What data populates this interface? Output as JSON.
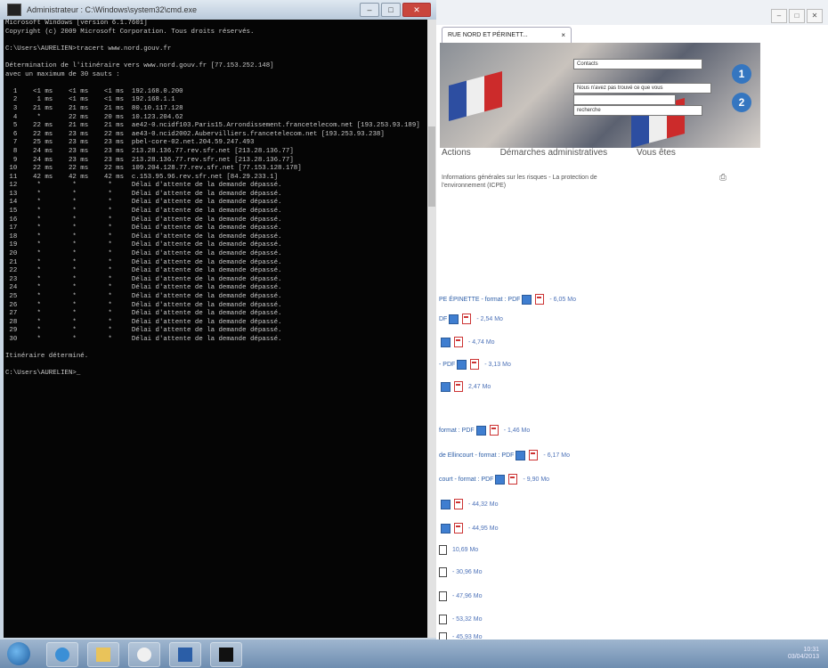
{
  "cmd": {
    "title": "Administrateur : C:\\Windows\\system32\\cmd.exe",
    "window_buttons": {
      "min": "–",
      "max": "□",
      "close": "✕"
    },
    "lines": [
      "Microsoft Windows [version 6.1.7601]",
      "Copyright (c) 2009 Microsoft Corporation. Tous droits réservés.",
      "",
      "C:\\Users\\AURELIEN>tracert www.nord.gouv.fr",
      "",
      "Détermination de l'itinéraire vers www.nord.gouv.fr [77.153.252.148]",
      "avec un maximum de 30 sauts :",
      "",
      "  1    <1 ms    <1 ms    <1 ms  192.168.0.200",
      "  2     1 ms    <1 ms    <1 ms  192.168.1.1",
      "  3    21 ms    21 ms    21 ms  80.10.117.128",
      "  4     *       22 ms    20 ms  10.123.204.62",
      "  5    22 ms    21 ms    21 ms  ae42-0.ncidf103.Paris15.Arrondissement.francetelecom.net [193.253.93.189]",
      "  6    22 ms    23 ms    22 ms  ae43-0.ncid2002.Aubervilliers.francetelecom.net [193.253.93.238]",
      "  7    25 ms    23 ms    23 ms  pbel-core-02.net.204.59.247.493",
      "  8    24 ms    23 ms    23 ms  213.28.136.77.rev.sfr.net [213.28.136.77]",
      "  9    24 ms    23 ms    23 ms  213.28.136.77.rev.sfr.net [213.28.136.77]",
      " 10    22 ms    22 ms    22 ms  109.204.128.77.rev.sfr.net [77.153.128.178]",
      " 11    42 ms    42 ms    42 ms  c.153.95.96.rev.sfr.net [84.29.233.1]",
      " 12     *        *        *     Délai d'attente de la demande dépassé.",
      " 13     *        *        *     Délai d'attente de la demande dépassé.",
      " 14     *        *        *     Délai d'attente de la demande dépassé.",
      " 15     *        *        *     Délai d'attente de la demande dépassé.",
      " 16     *        *        *     Délai d'attente de la demande dépassé.",
      " 17     *        *        *     Délai d'attente de la demande dépassé.",
      " 18     *        *        *     Délai d'attente de la demande dépassé.",
      " 19     *        *        *     Délai d'attente de la demande dépassé.",
      " 20     *        *        *     Délai d'attente de la demande dépassé.",
      " 21     *        *        *     Délai d'attente de la demande dépassé.",
      " 22     *        *        *     Délai d'attente de la demande dépassé.",
      " 23     *        *        *     Délai d'attente de la demande dépassé.",
      " 24     *        *        *     Délai d'attente de la demande dépassé.",
      " 25     *        *        *     Délai d'attente de la demande dépassé.",
      " 26     *        *        *     Délai d'attente de la demande dépassé.",
      " 27     *        *        *     Délai d'attente de la demande dépassé.",
      " 28     *        *        *     Délai d'attente de la demande dépassé.",
      " 29     *        *        *     Délai d'attente de la demande dépassé.",
      " 30     *        *        *     Délai d'attente de la demande dépassé.",
      "",
      "Itinéraire déterminé.",
      "",
      "C:\\Users\\AURELIEN>_"
    ]
  },
  "browser": {
    "tab_title": "RUE NORD ET PÉRINETT...",
    "tab_close": "×",
    "window_buttons": {
      "min": "–",
      "max": "□",
      "close": "✕"
    },
    "banner": {
      "fields": [
        "Contacts",
        "Nous n'avez pas trouvé ce que vous",
        "",
        "recherche"
      ],
      "badges": [
        "1",
        "2"
      ]
    },
    "menu": [
      "Actions",
      "Démarches administratives",
      "Vous êtes"
    ],
    "info_text": "Informations générales sur les risques - La protection de l'environnement (ICPE)",
    "print_icon": "⎙",
    "downloads": [
      {
        "label": "PE ÉPINETTE - format : PDF",
        "size": "- 6,05 Mo"
      },
      {
        "label": "DF",
        "size": "- 2,54 Mo"
      },
      {
        "label": "",
        "size": "- 4,74 Mo"
      },
      {
        "label": "- PDF",
        "size": "- 3,13 Mo"
      },
      {
        "label": "",
        "size": "2,47 Mo"
      },
      {
        "label": "format : PDF",
        "size": "- 1,46 Mo"
      },
      {
        "label": "de Ellincourt - format : PDF",
        "size": "- 6,17 Mo"
      },
      {
        "label": "court - format : PDF",
        "size": "- 9,90 Mo"
      },
      {
        "label": "",
        "size": "- 44,32 Mo"
      },
      {
        "label": "",
        "size": "- 44,95 Mo"
      },
      {
        "label": "",
        "size": "10,69 Mo"
      },
      {
        "label": "",
        "size": "- 30,96 Mo"
      },
      {
        "label": "",
        "size": "- 47,96 Mo"
      },
      {
        "label": "",
        "size": "- 53,32 Mo"
      },
      {
        "label": "",
        "size": "- 45,93 Mo"
      }
    ]
  },
  "taskbar": {
    "items": [
      "ie",
      "explorer",
      "media",
      "word",
      "cmd"
    ],
    "tray_time": "10:31",
    "tray_date": "03/04/2013"
  }
}
